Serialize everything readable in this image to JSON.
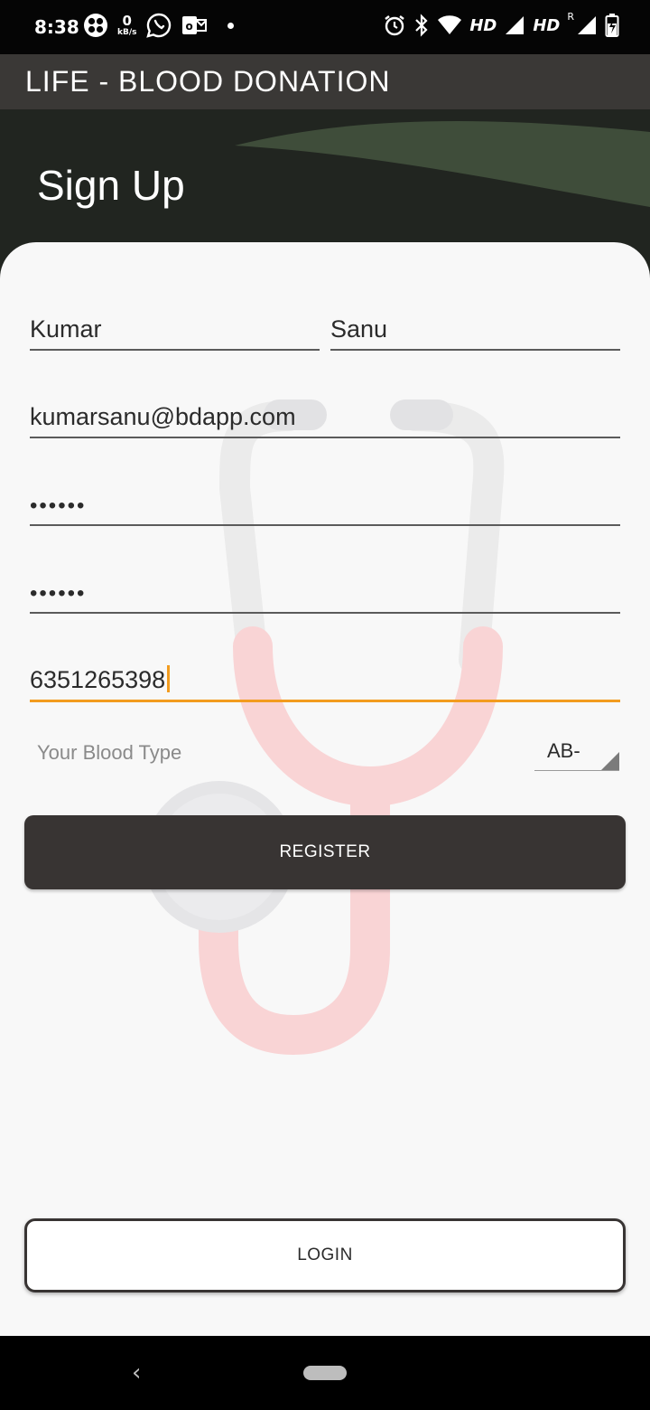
{
  "status_bar": {
    "time": "8:38",
    "data_speed_value": "0",
    "data_speed_unit": "kB/s",
    "network1": "HD",
    "network2": "HD",
    "roaming": "R",
    "icons": [
      "fan-icon",
      "whatsapp-icon",
      "outlook-icon",
      "notification-dot-icon",
      "alarm-icon",
      "bluetooth-icon",
      "wifi-icon",
      "signal-icon",
      "signal-icon",
      "battery-charging-icon"
    ]
  },
  "app_bar": {
    "title": "LIFE - BLOOD DONATION"
  },
  "header": {
    "title": "Sign Up"
  },
  "form": {
    "first_name": "Kumar",
    "last_name": "Sanu",
    "email": "kumarsanu@bdapp.com",
    "password": "••••••",
    "confirm_password": "••••••",
    "phone": "6351265398",
    "blood_type_label": "Your Blood Type",
    "blood_type_value": "AB-"
  },
  "buttons": {
    "register": "REGISTER",
    "login": "LOGIN"
  },
  "nav": {
    "back": "‹"
  },
  "colors": {
    "app_bar": "#3a3836",
    "header_dark": "#212520",
    "header_wave": "#3f4d3a",
    "accent": "#f29c1f",
    "button_dark": "#383433"
  }
}
